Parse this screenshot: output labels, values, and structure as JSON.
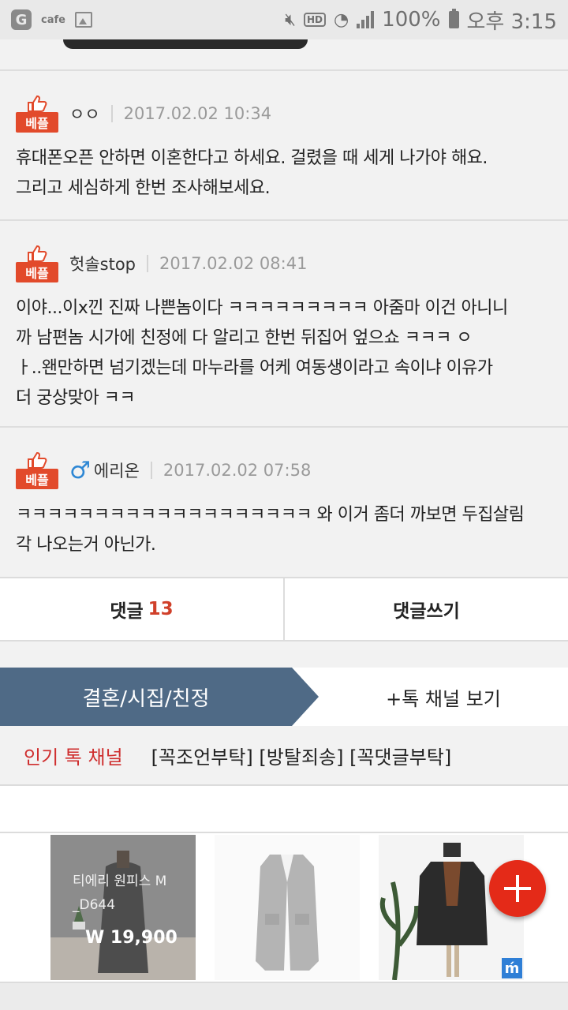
{
  "status_bar": {
    "app_name": "cafe",
    "battery": "100%",
    "time": "오후 3:15",
    "hd": "HD"
  },
  "comments": [
    {
      "badge": "베플",
      "nick": "ㅇㅇ",
      "date": "2017.02.02 10:34",
      "lines": [
        "휴대폰오픈 안하면 이혼한다고 하세요. 걸렸을 때 세게 나가야 해요.",
        "그리고 세심하게 한번 조사해보세요."
      ]
    },
    {
      "badge": "베플",
      "nick": "헛솔stop",
      "date": "2017.02.02 08:41",
      "lines": [
        "이야...이x낀 진짜 나쁜놈이다 ㅋㅋㅋㅋㅋㅋㅋㅋㅋ 아줌마 이건 아니니",
        "까 남편놈 시가에 친정에 다 알리고 한번 뒤집어 엎으쇼 ㅋㅋㅋ ㅇ",
        "ㅏ..왠만하면 넘기겠는데 마누라를 어케 여동생이라고 속이냐 이유가",
        "더 궁상맞아 ㅋㅋ"
      ]
    },
    {
      "badge": "베플",
      "nick": "에리온",
      "gender_icon": "♂",
      "date": "2017.02.02 07:58",
      "lines": [
        "ㅋㅋㅋㅋㅋㅋㅋㅋㅋㅋㅋㅋㅋㅋㅋㅋㅋㅋㅋ 와 이거 좀더 까보면 두집살림",
        "각 나오는거 아닌가."
      ]
    }
  ],
  "tabs": {
    "comments_label": "댓글",
    "comments_count": "13",
    "write_label": "댓글쓰기"
  },
  "channel": {
    "category": "결혼/시집/친정",
    "more": "+톡 채널 보기"
  },
  "popular": {
    "label": "인기 톡 채널",
    "tags": "[꼭조언부탁] [방탈죄송] [꼭댓글부탁]"
  },
  "products": [
    {
      "name_line1": "티에리 원피스 M",
      "name_line2": "_D644",
      "price": "W 19,900"
    },
    {},
    {
      "ad_mark": "ḿ"
    }
  ],
  "colors": {
    "accent_red": "#e24a2b",
    "channel_blue": "#4f6a86",
    "count_red": "#d0402a"
  }
}
